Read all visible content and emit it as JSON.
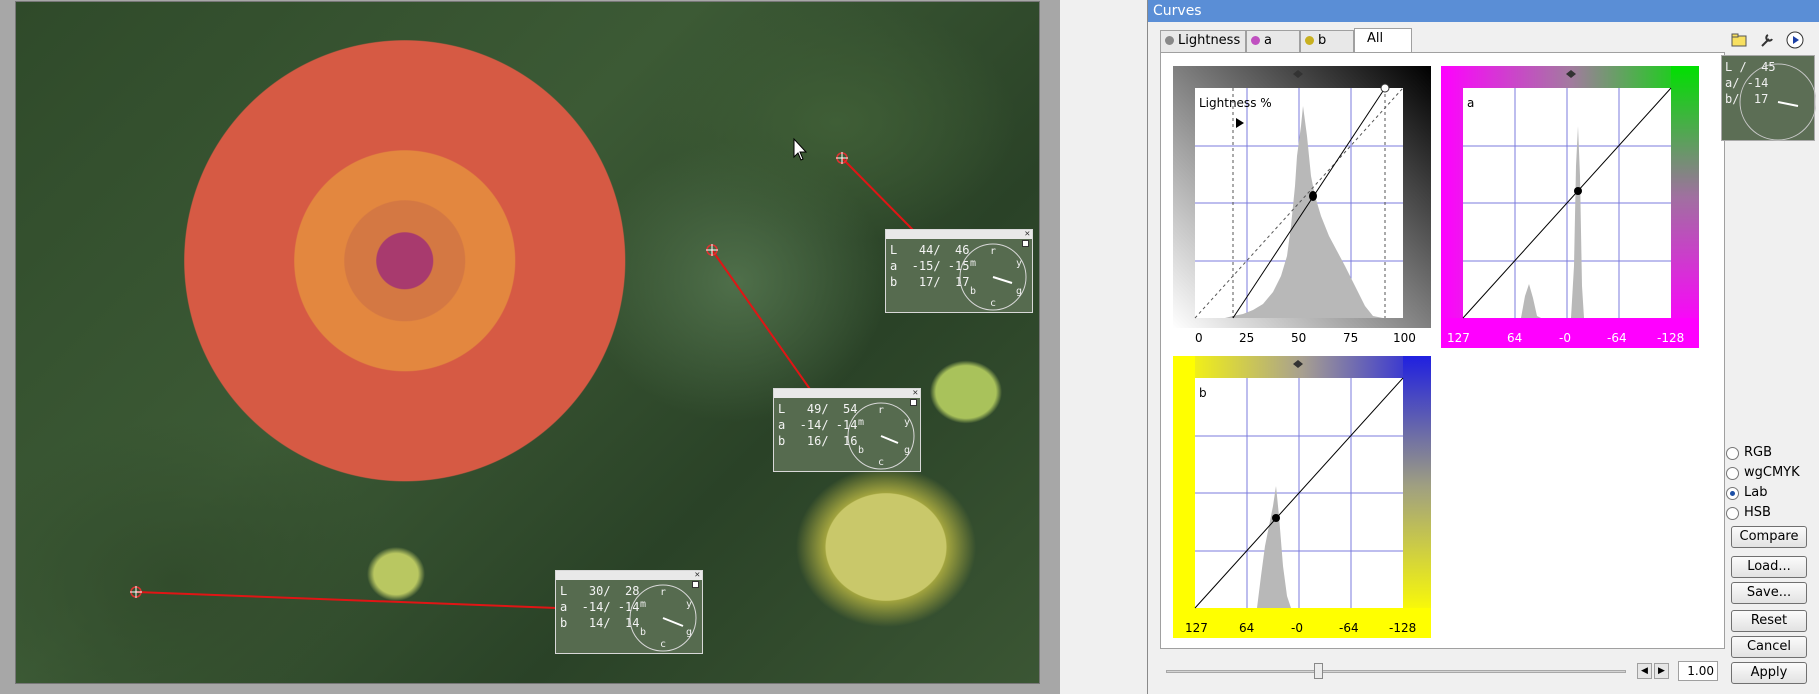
{
  "window": {
    "title": "Curves"
  },
  "tabs": [
    {
      "label": "Lightness",
      "dot": "#888888"
    },
    {
      "label": "a",
      "dot": "#c050c0"
    },
    {
      "label": "b",
      "dot": "#c8b020"
    },
    {
      "label": "All",
      "dot": ""
    }
  ],
  "active_tab": "All",
  "graphs": {
    "lightness": {
      "label": "Lightness %",
      "ticks": [
        "0",
        "25",
        "50",
        "75",
        "100"
      ]
    },
    "a": {
      "label": "a",
      "ticks": [
        "127",
        "64",
        "-0",
        "-64",
        "-128"
      ]
    },
    "b": {
      "label": "b",
      "ticks": [
        "127",
        "64",
        "-0",
        "-64",
        "-128"
      ]
    }
  },
  "samplers": [
    {
      "L": "L   44/  46",
      "a": "a  -15/ -15",
      "b": "b   17/  17"
    },
    {
      "L": "L   49/  54",
      "a": "a  -14/ -14",
      "b": "b   16/  16"
    },
    {
      "L": "L   30/  28",
      "a": "a  -14/ -14",
      "b": "b   14/  14"
    }
  ],
  "dial_letters": {
    "r": "r",
    "m": "m",
    "y": "y",
    "b": "b",
    "g": "g",
    "c": "c"
  },
  "readout": {
    "L": "L /  45",
    "a": "a/ -14",
    "b": "b/  17"
  },
  "modes": [
    {
      "label": "RGB",
      "selected": false
    },
    {
      "label": "wgCMYK",
      "selected": false
    },
    {
      "label": "Lab",
      "selected": true
    },
    {
      "label": "HSB",
      "selected": false
    }
  ],
  "buttons": {
    "compare": "Compare",
    "load": "Load...",
    "save": "Save...",
    "reset": "Reset",
    "cancel": "Cancel",
    "apply": "Apply"
  },
  "slider": {
    "value": "1.00",
    "position": 0.33
  },
  "icons": {
    "toolbar": [
      "folder-icon",
      "wrench-icon",
      "play-icon"
    ],
    "slider": [
      "arrow-left-icon",
      "arrow-right-icon"
    ]
  }
}
